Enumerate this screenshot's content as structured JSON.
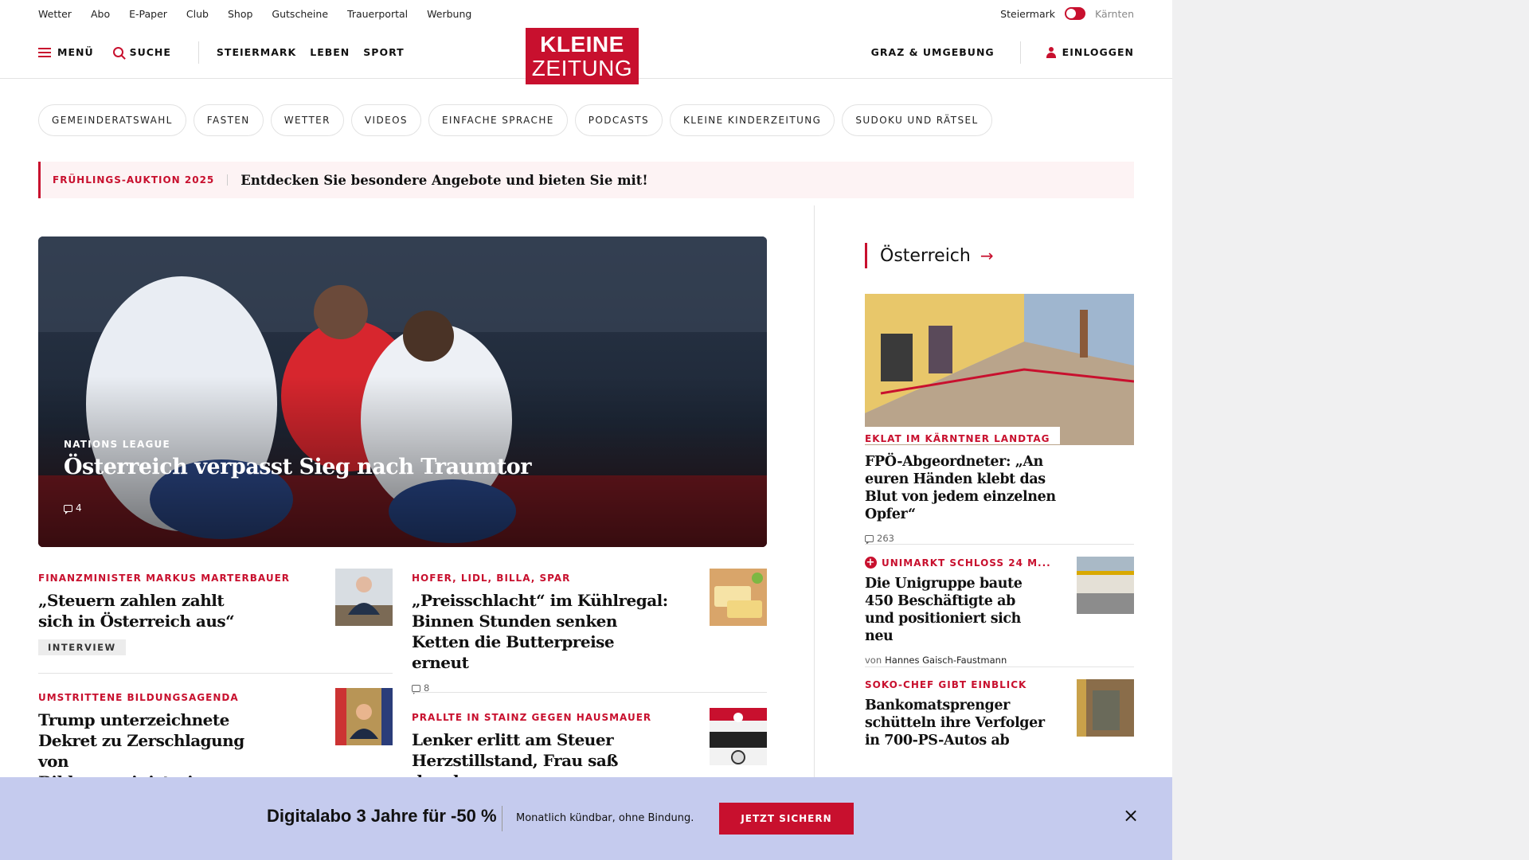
{
  "utility": {
    "links": [
      "Wetter",
      "Abo",
      "E-Paper",
      "Club",
      "Shop",
      "Gutscheine",
      "Trauerportal",
      "Werbung"
    ],
    "region_active": "Steiermark",
    "region_inactive": "Kärnten"
  },
  "header": {
    "menu": "MENÜ",
    "search": "SUCHE",
    "nav": [
      "STEIERMARK",
      "LEBEN",
      "SPORT"
    ],
    "logo_line1": "KLEINE",
    "logo_line2": "ZEITUNG",
    "local": "GRAZ & UMGEBUNG",
    "login": "EINLOGGEN"
  },
  "pills": [
    "GEMEINDERATSWAHL",
    "FASTEN",
    "WETTER",
    "VIDEOS",
    "EINFACHE SPRACHE",
    "PODCASTS",
    "KLEINE KINDERZEITUNG",
    "SUDOKU UND RÄTSEL"
  ],
  "promo": {
    "kicker": "FRÜHLINGS-AUKTION 2025",
    "text": "Entdecken Sie besondere Angebote und bieten Sie mit!"
  },
  "hero": {
    "kicker": "NATIONS LEAGUE",
    "title": "Österreich verpasst Sieg nach Traumtor",
    "comments": "4"
  },
  "articles": {
    "a1": {
      "kicker": "FINANZMINISTER MARKUS MARTERBAUER",
      "title": "„Steuern zahlen zahlt sich in Österreich aus“",
      "badge": "INTERVIEW"
    },
    "a2": {
      "kicker": "HOFER, LIDL, BILLA, SPAR",
      "title": "„Preisschlacht“ im Kühlregal: Binnen Stunden senken Ketten die Butterpreise erneut",
      "comments": "8"
    },
    "a3": {
      "kicker": "UMSTRITTENE BILDUNGSAGENDA",
      "title": "Trump unterzeichnete Dekret zu Zerschlagung von Bildungsministerium"
    },
    "a4": {
      "kicker": "PRALLTE IN STAINZ GEGEN HAUSMAUER",
      "title": "Lenker erlitt am Steuer Herzstillstand, Frau saß daneben"
    }
  },
  "sidebar": {
    "section": "Österreich",
    "s1": {
      "kicker": "EKLAT IM KÄRNTNER LANDTAG",
      "title": "FPÖ-Abgeordneter: „An euren Händen klebt das Blut von jedem einzelnen Opfer“",
      "comments": "263"
    },
    "s2": {
      "kicker": "UNIMARKT SCHLOSS 24 M...",
      "title": "Die Unigruppe baute 450 Beschäftigte ab und positioniert sich neu",
      "author_prefix": "von",
      "author": "Hannes Gaisch-Faustmann"
    },
    "s3": {
      "kicker": "SOKO-CHEF GIBT EINBLICK",
      "title": "Bankomatsprenger schütteln ihre Verfolger in 700-PS-Autos ab"
    }
  },
  "banner": {
    "title": "Digitalabo 3 Jahre für -50 %",
    "subtitle": "Monatlich kündbar, ohne Bindung.",
    "cta": "JETZT SICHERN"
  },
  "colors": {
    "brand": "#c8102e",
    "banner_bg": "#c5cbee",
    "promo_bg": "#fdf3f4"
  }
}
